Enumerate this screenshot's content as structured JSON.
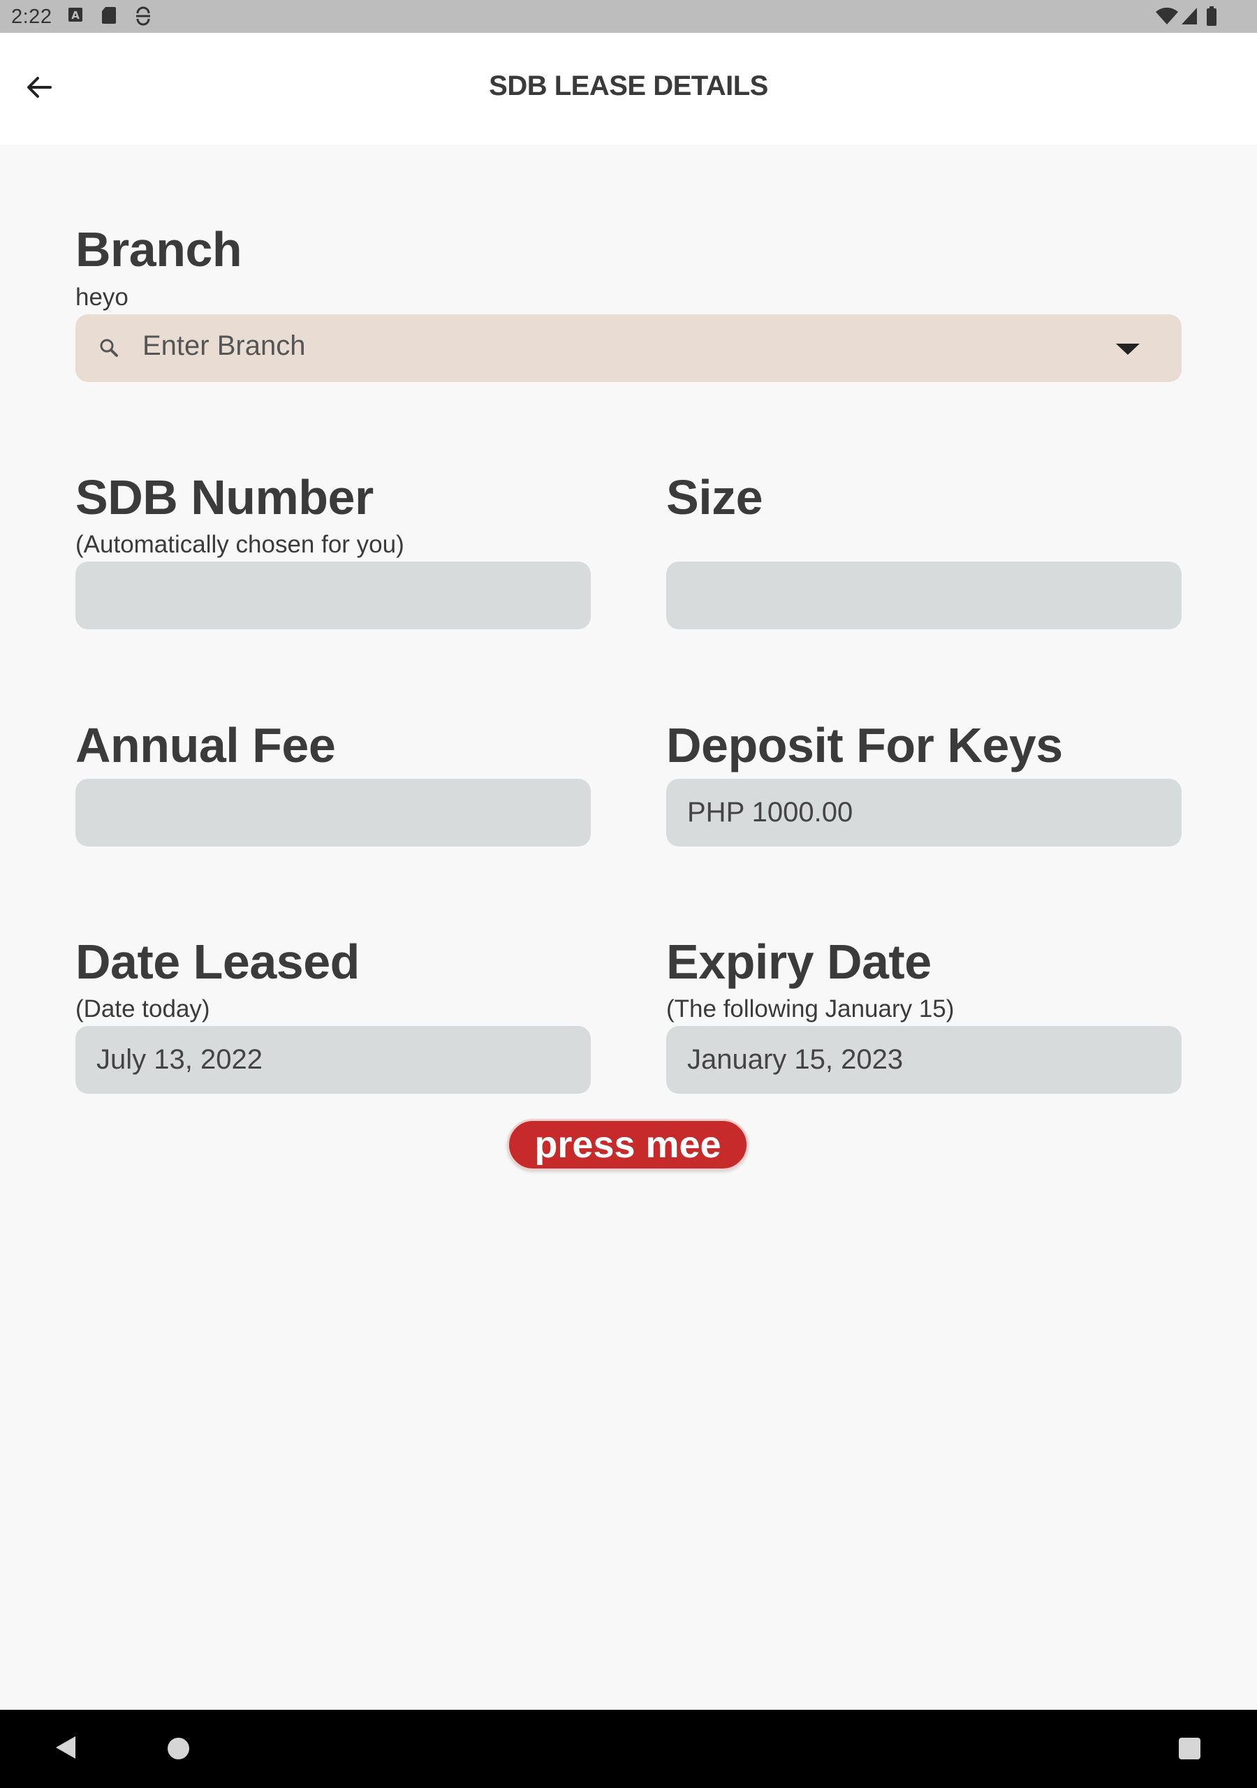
{
  "status_bar": {
    "time": "2:22",
    "icons": [
      "a-box-icon",
      "sd-card-icon",
      "sync-icon",
      "wifi-icon",
      "cell-signal-icon",
      "battery-icon"
    ]
  },
  "app_bar": {
    "title": "SDB LEASE DETAILS",
    "back_icon": "arrow-left-icon"
  },
  "form": {
    "branch": {
      "label": "Branch",
      "sublabel": "heyo",
      "placeholder": "Enter Branch",
      "value": ""
    },
    "sdb_number": {
      "label": "SDB Number",
      "sublabel": "(Automatically chosen for you)",
      "value": ""
    },
    "size": {
      "label": "Size",
      "value": ""
    },
    "annual_fee": {
      "label": "Annual Fee",
      "value": ""
    },
    "deposit_for_keys": {
      "label": "Deposit For Keys",
      "value": "PHP 1000.00"
    },
    "date_leased": {
      "label": "Date Leased",
      "sublabel": "(Date today)",
      "value": "July 13, 2022"
    },
    "expiry_date": {
      "label": "Expiry Date",
      "sublabel": "(The following January 15)",
      "value": "January 15, 2023"
    },
    "submit_label": "press mee"
  },
  "colors": {
    "accent": "#c62a2a",
    "branch_field_bg": "#e9ddd3",
    "field_bg": "#d7dbdb",
    "page_bg": "#f8f8f8"
  }
}
